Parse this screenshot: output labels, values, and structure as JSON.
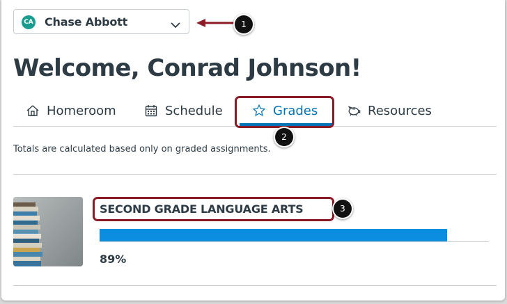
{
  "student_selector": {
    "initials": "CA",
    "name": "Chase Abbott",
    "avatar_color": "#1a9d8e"
  },
  "welcome": "Welcome, Conrad Johnson!",
  "tabs": [
    {
      "label": "Homeroom",
      "icon": "home-icon",
      "active": false
    },
    {
      "label": "Schedule",
      "icon": "calendar-icon",
      "active": false
    },
    {
      "label": "Grades",
      "icon": "star-icon",
      "active": true
    },
    {
      "label": "Resources",
      "icon": "piggy-bank-icon",
      "active": false
    }
  ],
  "grades_note": "Totals are calculated based only on graded assignments.",
  "courses": [
    {
      "title": "SECOND GRADE LANGUAGE ARTS",
      "progress": 0.89,
      "grade": "89%"
    }
  ],
  "callouts": [
    "1",
    "2",
    "3"
  ],
  "colors": {
    "accent": "#0374b5",
    "progress": "#0b8de0",
    "annotation": "#8b1c26",
    "text": "#2d3b45"
  }
}
